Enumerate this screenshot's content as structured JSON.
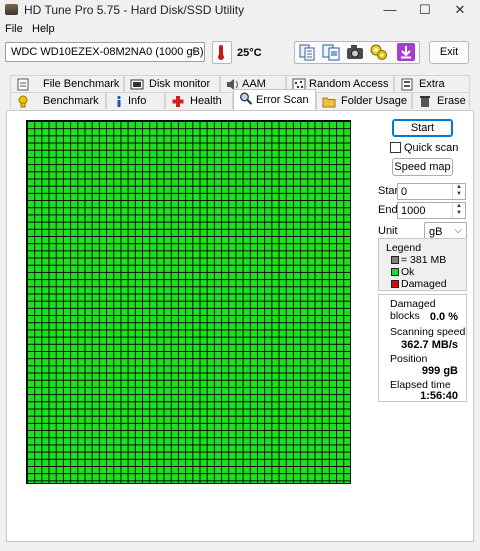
{
  "window": {
    "title": "HD Tune Pro 5.75 - Hard Disk/SSD Utility"
  },
  "window_controls": {
    "minimize": "—",
    "maximize": "☐",
    "close": "✕"
  },
  "menu": {
    "file": "File",
    "help": "Help"
  },
  "toolbar": {
    "drive": "WDC WD10EZEX-08M2NA0 (1000 gB)",
    "temperature": "25°C",
    "exit_label": "Exit",
    "icons": [
      "copy-info-icon",
      "copy-screenshot-icon",
      "save-screenshot-icon",
      "options-icon",
      "download-icon"
    ]
  },
  "tabs_row1": [
    {
      "label": "File Benchmark",
      "icon": "file-benchmark-icon"
    },
    {
      "label": "Disk monitor",
      "icon": "disk-monitor-icon"
    },
    {
      "label": "AAM",
      "icon": "speaker-icon"
    },
    {
      "label": "Random Access",
      "icon": "random-access-icon"
    },
    {
      "label": "Extra tests",
      "icon": "extra-tests-icon"
    }
  ],
  "tabs_row2": [
    {
      "label": "Benchmark",
      "icon": "benchmark-icon"
    },
    {
      "label": "Info",
      "icon": "info-icon"
    },
    {
      "label": "Health",
      "icon": "health-icon"
    },
    {
      "label": "Error Scan",
      "icon": "magnifier-icon",
      "active": true
    },
    {
      "label": "Folder Usage",
      "icon": "folder-icon"
    },
    {
      "label": "Erase",
      "icon": "trash-icon"
    }
  ],
  "scan": {
    "start_button": "Start",
    "quick_scan_label": "Quick scan",
    "quick_scan_checked": false,
    "speed_map_button": "Speed map",
    "start_label": "Start",
    "start_value": "0",
    "end_label": "End",
    "end_value": "1000",
    "unit_label": "Unit",
    "unit_value": "gB",
    "grid_status": "ok",
    "grid_color": "#1ee01e"
  },
  "legend": {
    "title": "Legend",
    "block": "= 381 MB",
    "ok": "Ok",
    "damaged": "Damaged",
    "colors": {
      "block": "#808080",
      "ok": "#1ee01e",
      "damaged": "#d01010"
    }
  },
  "stats": {
    "damaged_label": "Damaged blocks",
    "damaged_value": "0.0 %",
    "speed_label": "Scanning speed",
    "speed_value": "362.7 MB/s",
    "position_label": "Position",
    "position_value": "999 gB",
    "elapsed_label": "Elapsed time",
    "elapsed_value": "1:56:40"
  }
}
